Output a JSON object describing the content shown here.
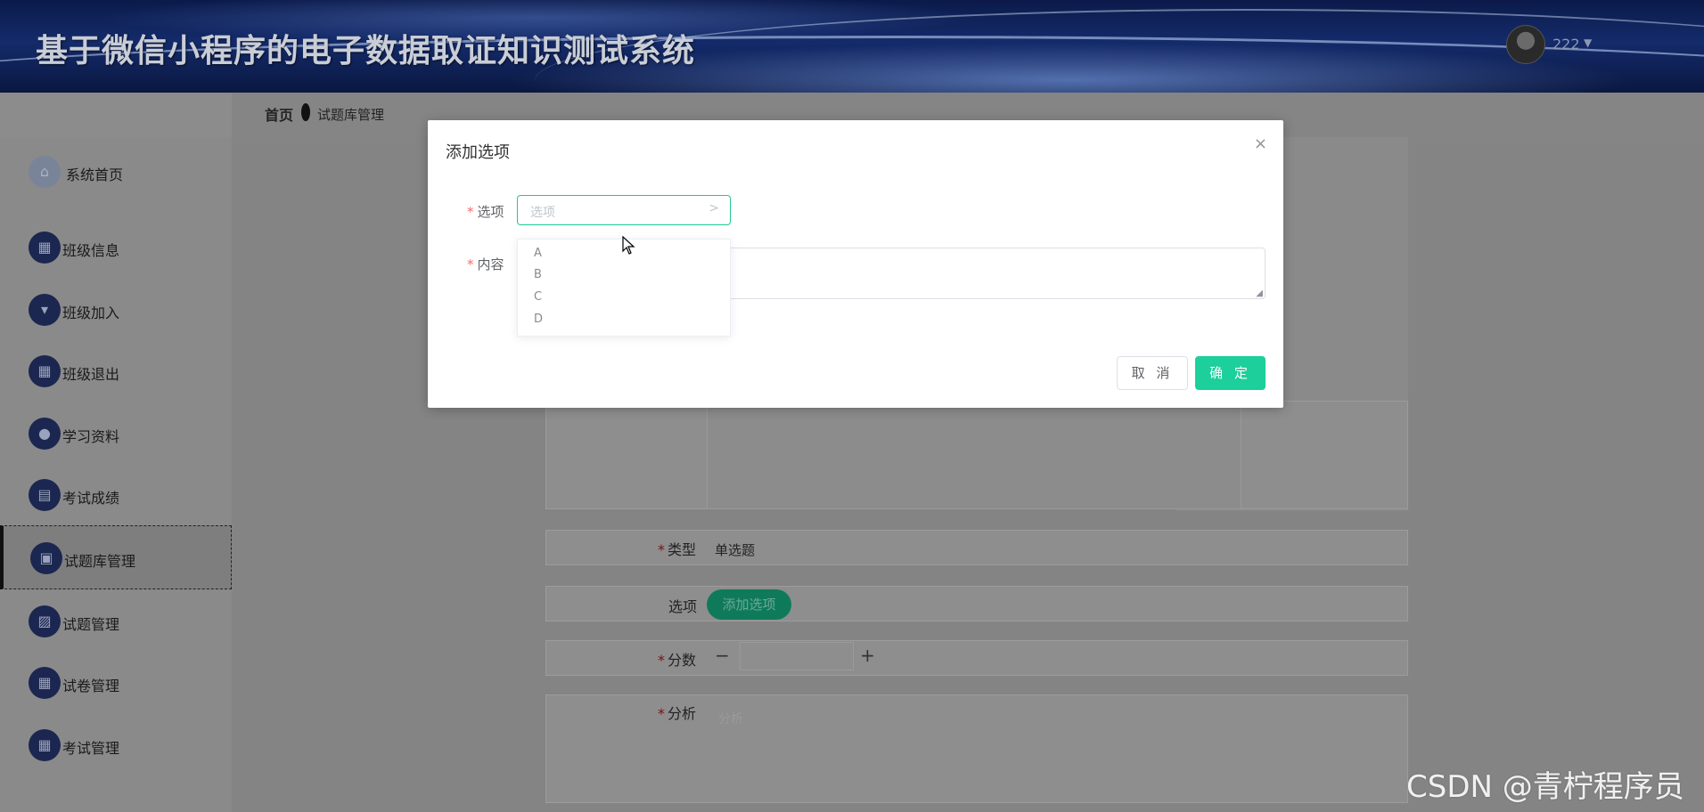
{
  "header": {
    "title": "基于微信小程序的电子数据取证知识测试系统",
    "username": "222"
  },
  "breadcrumb": {
    "home": "首页",
    "current": "试题库管理"
  },
  "sidebar": {
    "items": [
      {
        "label": "系统首页",
        "icon": "home-icon"
      },
      {
        "label": "班级信息",
        "icon": "grid-icon"
      },
      {
        "label": "班级加入",
        "icon": "pin-icon"
      },
      {
        "label": "班级退出",
        "icon": "grid-icon"
      },
      {
        "label": "学习资料",
        "icon": "user-icon"
      },
      {
        "label": "考试成绩",
        "icon": "table-icon"
      },
      {
        "label": "试题库管理",
        "icon": "briefcase-icon",
        "active": true
      },
      {
        "label": "试题管理",
        "icon": "chart-icon"
      },
      {
        "label": "试卷管理",
        "icon": "grid-icon"
      },
      {
        "label": "考试管理",
        "icon": "grid-icon"
      }
    ]
  },
  "form": {
    "type_label": "类型",
    "type_value": "单选题",
    "options_label": "选项",
    "add_option_button": "添加选项",
    "score_label": "分数",
    "minus": "−",
    "plus": "+",
    "analysis_label": "分析",
    "analysis_placeholder": "分析"
  },
  "dialog": {
    "title": "添加选项",
    "close": "×",
    "option_label": "选项",
    "option_placeholder": "选项",
    "content_label": "内容",
    "dropdown_options": [
      "A",
      "B",
      "C",
      "D"
    ],
    "cancel": "取 消",
    "confirm": "确 定"
  },
  "watermark": "CSDN @青柠程序员",
  "colors": {
    "accent": "#1ccf9b",
    "header": "#142b6b",
    "danger": "#f56c6c"
  }
}
